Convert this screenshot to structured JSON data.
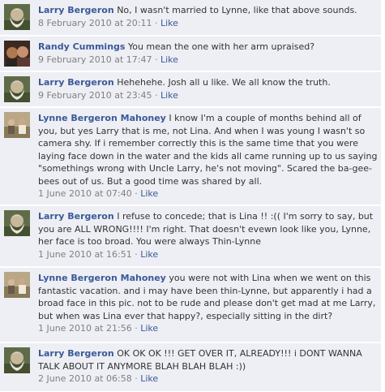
{
  "comments": [
    {
      "author": "Larry Bergeron",
      "text": "No, I wasn't married to Lynne, like that above sounds.",
      "timestamp": "8 February 2010 at 20:11",
      "like_label": "Like",
      "avatar": "larry-avatar"
    },
    {
      "author": "Randy Cummings",
      "text": "You mean the one with her arm upraised?",
      "timestamp": "9 February 2010 at 17:47",
      "like_label": "Like",
      "avatar": "randy-avatar"
    },
    {
      "author": "Larry Bergeron",
      "text": "Hehehehe. Josh all u like. We all know the truth.",
      "timestamp": "9 February 2010 at 23:45",
      "like_label": "Like",
      "avatar": "larry-avatar"
    },
    {
      "author": "Lynne Bergeron Mahoney",
      "text": "I know I'm a couple of months behind all of you, but yes Larry that is me, not Lina. And when I was young I wasn't so camera shy. If i remember correctly this is the same time that you were laying face down in the water and the kids all came running up to us saying \"somethings wrong with Uncle Larry, he's not moving\". Scared the ba-gee-bees out of us. But a good time was shared by all.",
      "timestamp": "1 June 2010 at 07:40",
      "like_label": "Like",
      "avatar": "lynne-avatar"
    },
    {
      "author": "Larry Bergeron",
      "text": "I refuse to concede; that is Lina !! :(( I'm sorry to say, but you are ALL WRONG!!!! I'm right. That doesn't evewn look like you, Lynne, her face is too broad. You were always Thin-Lynne",
      "timestamp": "1 June 2010 at 16:51",
      "like_label": "Like",
      "avatar": "larry-avatar"
    },
    {
      "author": "Lynne Bergeron Mahoney",
      "text": "you were not with Lina when we went on this fantastic vacation. and i may have been thin-Lynne, but apparently i had a broad face in this pic. not to be rude and please don't get mad at me Larry, but when was Lina ever that happy?, especially sitting in the dirt?",
      "timestamp": "1 June 2010 at 21:56",
      "like_label": "Like",
      "avatar": "lynne-avatar"
    },
    {
      "author": "Larry Bergeron",
      "text": "OK OK OK !!! GET OVER IT, ALREADY!!! i DONT WANNA TALK ABOUT IT ANYMORE BLAH BLAH BLAH :))",
      "timestamp": "2 June 2010 at 06:58",
      "like_label": "Like",
      "avatar": "larry-avatar"
    }
  ],
  "separator": "·",
  "colors": {
    "background": "#edeff4",
    "author_link": "#3b5998",
    "meta_text": "#808080",
    "body_text": "#333333"
  }
}
